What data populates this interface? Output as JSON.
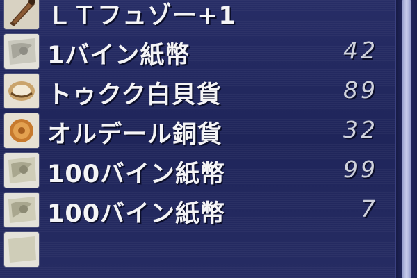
{
  "inventory": {
    "items": [
      {
        "name": "ＬＴフュゾー+1",
        "qty": "",
        "icon": "lt-fuseau-icon"
      },
      {
        "name": "1バイン紙幣",
        "qty": "42",
        "icon": "bayld-note-icon"
      },
      {
        "name": "トゥクク白貝貨",
        "qty": "89",
        "icon": "white-shell-icon"
      },
      {
        "name": "オルデール銅貨",
        "qty": "32",
        "icon": "bronze-coin-icon"
      },
      {
        "name": "100バイン紙幣",
        "qty": "99",
        "icon": "bayld-note-icon"
      },
      {
        "name": "100バイン紙幣",
        "qty": "7",
        "icon": "bayld-note-icon"
      }
    ]
  },
  "colors": {
    "background": "#232960",
    "text": "#f4f4f6",
    "quantity": "#cfd2dc",
    "scroll_thumb": "#c9cdec"
  }
}
